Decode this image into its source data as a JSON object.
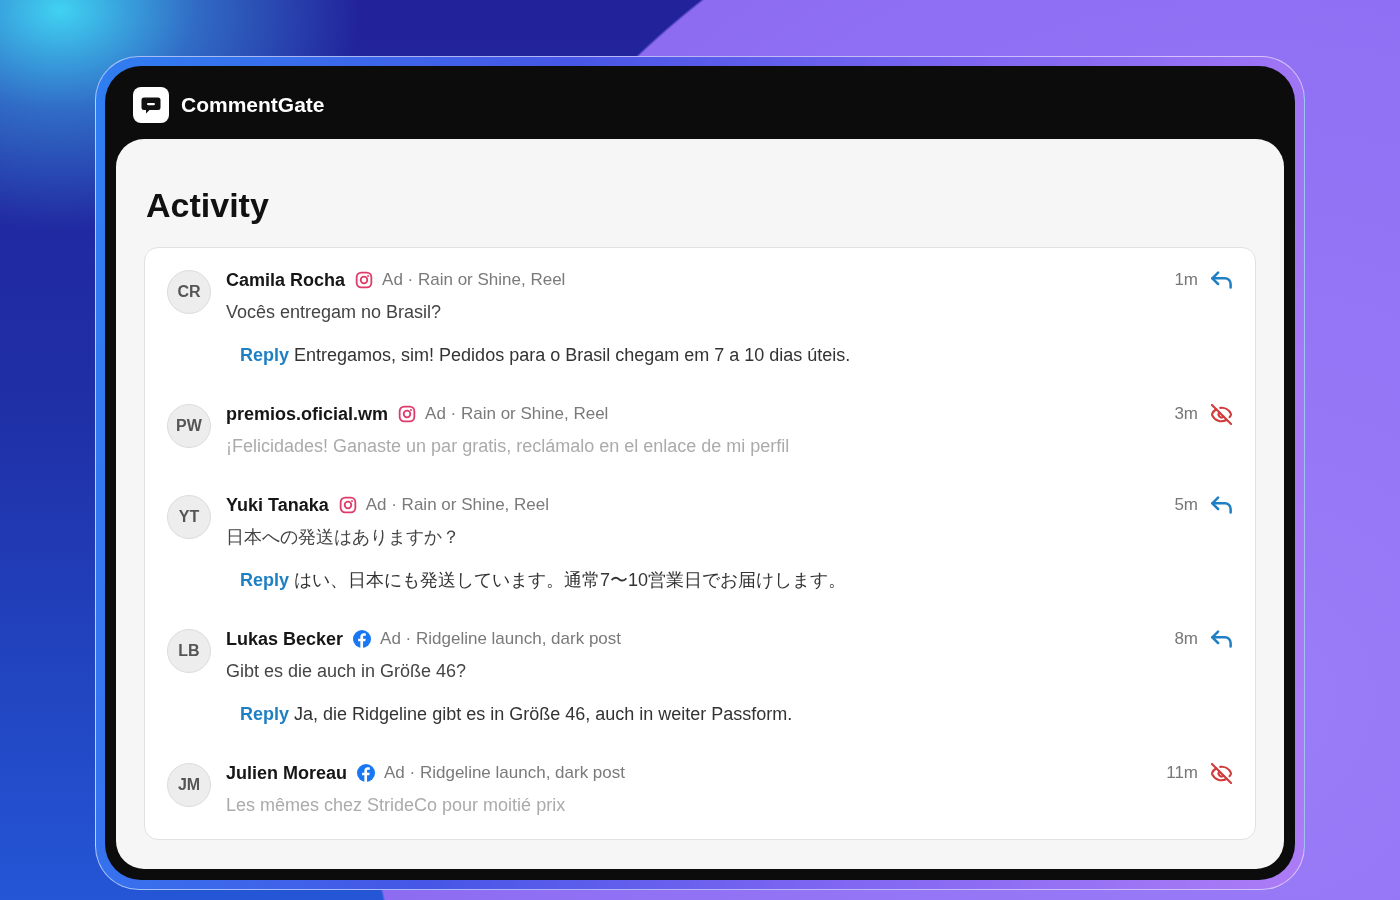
{
  "app": {
    "name": "CommentGate"
  },
  "page": {
    "title": "Activity"
  },
  "comments": [
    {
      "initials": "CR",
      "author": "Camila Rocha",
      "kind": "instagram",
      "meta": "Ad · Rain or Shine, Reel",
      "text": "Vocês entregam no Brasil?",
      "time": "1m",
      "hidden": false,
      "reply": {
        "label": "Reply",
        "text": "Entregamos, sim! Pedidos para o Brasil chegam em 7 a 10 dias úteis."
      }
    },
    {
      "initials": "PW",
      "author": "premios.oficial.wm",
      "kind": "instagram",
      "meta": "Ad · Rain or Shine, Reel",
      "text": "¡Felicidades! Ganaste un par gratis, reclámalo en el enlace de mi perfil",
      "time": "3m",
      "hidden": true
    },
    {
      "initials": "YT",
      "author": "Yuki Tanaka",
      "kind": "instagram",
      "meta": "Ad · Rain or Shine, Reel",
      "text": "日本への発送はありますか？",
      "time": "5m",
      "hidden": false,
      "reply": {
        "label": "Reply",
        "text": "はい、日本にも発送しています。通常7〜10営業日でお届けします。"
      }
    },
    {
      "initials": "LB",
      "author": "Lukas Becker",
      "kind": "facebook",
      "meta": "Ad · Ridgeline launch, dark post",
      "text": "Gibt es die auch in Größe 46?",
      "time": "8m",
      "hidden": false,
      "reply": {
        "label": "Reply",
        "text": "Ja, die Ridgeline gibt es in Größe 46, auch in weiter Passform."
      }
    },
    {
      "initials": "JM",
      "author": "Julien Moreau",
      "kind": "facebook",
      "meta": "Ad · Ridgeline launch, dark post",
      "text": "Les mêmes chez StrideCo pour moitié prix",
      "time": "11m",
      "hidden": true
    }
  ]
}
